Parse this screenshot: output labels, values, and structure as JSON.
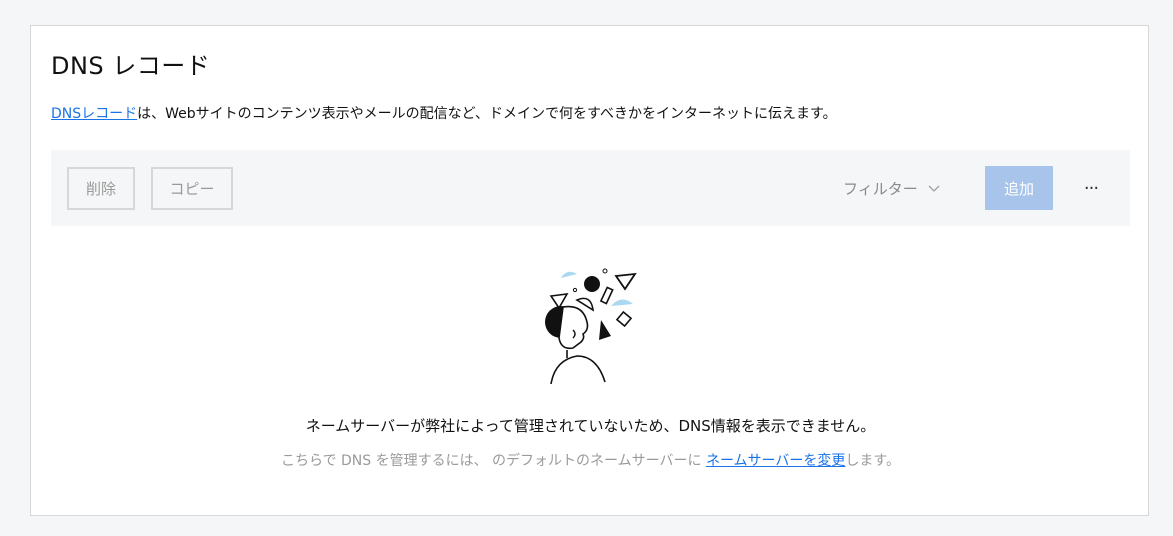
{
  "header": {
    "title": "DNS レコード"
  },
  "description": {
    "link_text": "DNSレコード",
    "text": "は、Webサイトのコンテンツ表示やメールの配信など、ドメインで何をすべきかをインターネットに伝えます。"
  },
  "toolbar": {
    "delete_label": "削除",
    "copy_label": "コピー",
    "filter_label": "フィルター",
    "add_label": "追加",
    "more_label": "···"
  },
  "empty_state": {
    "illustration_icon": "person-with-floating-shapes-icon",
    "message": "ネームサーバーが弊社によって管理されていないため、DNS情報を表示できません。",
    "hint_prefix": "こちらで DNS を管理するには、 のデフォルトのネームサーバーに ",
    "hint_link": "ネームサーバーを変更",
    "hint_suffix": "します。"
  },
  "colors": {
    "link": "#1a73e8",
    "add_button_disabled": "#a8c4ea",
    "toolbar_bg": "#f5f6f7",
    "illustration_accent": "#a9d8f0"
  }
}
